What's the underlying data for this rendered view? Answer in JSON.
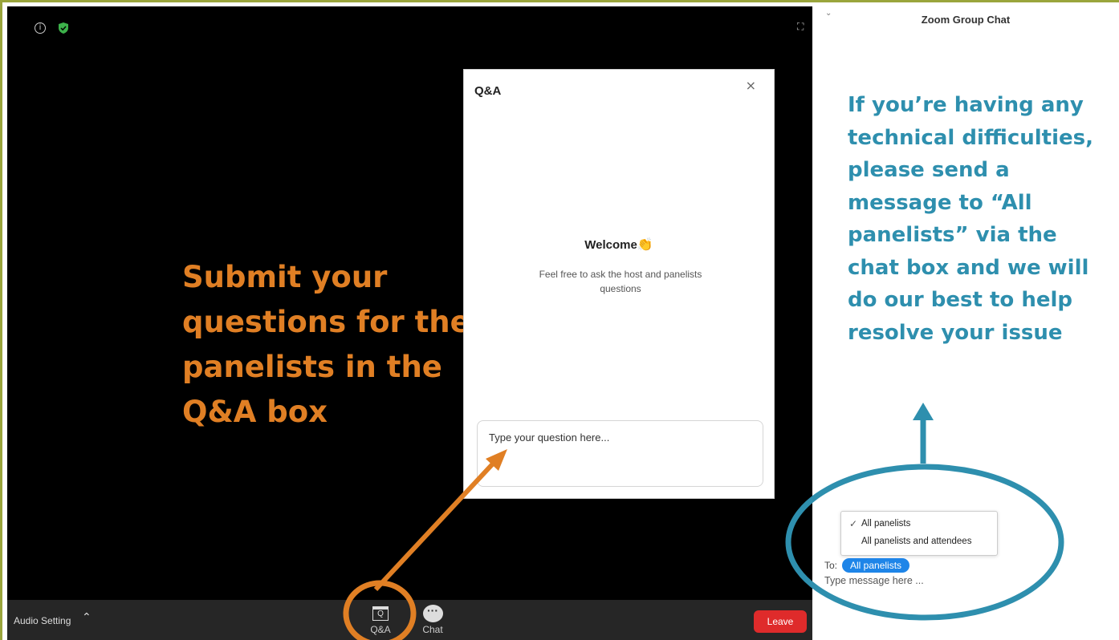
{
  "toolbar": {
    "audio_label": "Audio Setting",
    "qa_label": "Q&A",
    "qa_icon_letter": "Q",
    "chat_label": "Chat",
    "leave_label": "Leave"
  },
  "qa_dialog": {
    "title": "Q&A",
    "close_glyph": "×",
    "welcome": "Welcome",
    "description": "Feel free to ask the host and panelists questions",
    "input_placeholder": "Type your question here..."
  },
  "chat": {
    "title": "Zoom Group Chat",
    "dropdown_options": [
      "All panelists",
      "All panelists and attendees"
    ],
    "to_label": "To:",
    "to_selected": "All panelists",
    "input_placeholder": "Type message here ..."
  },
  "annotations": {
    "left_text": "Submit your questions for the panelists in the Q&A box",
    "right_text": "If you’re having any technical difficulties, please send a message to “All panelists” via the chat box and we will do our best to help resolve your issue",
    "orange": "#e07f24",
    "blue": "#2e8fae"
  },
  "colors": {
    "leave": "#df2b2b",
    "pill": "#1e85e8",
    "frame": "#9aa53c"
  }
}
